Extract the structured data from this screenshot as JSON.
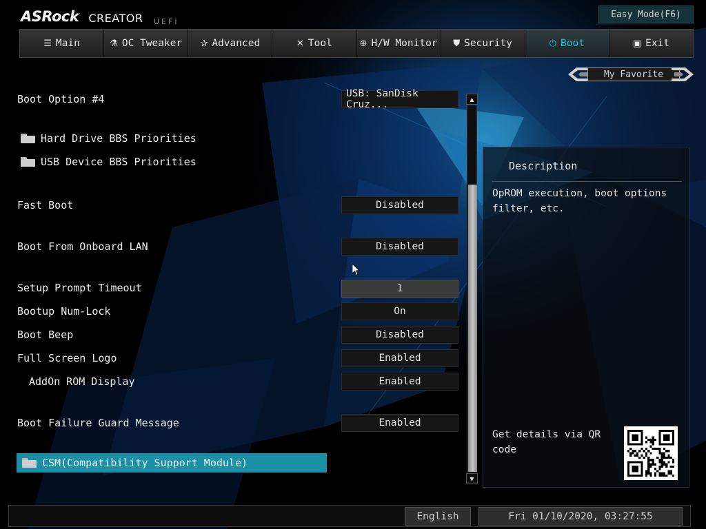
{
  "header": {
    "brand": "ASRock",
    "product": "CREATOR",
    "sublabel": "UEFI",
    "easy_mode_label": "Easy Mode(F6)"
  },
  "tabs": [
    {
      "label": "Main",
      "icon": "list-icon",
      "active": false
    },
    {
      "label": "OC Tweaker",
      "icon": "rocket-icon",
      "active": false
    },
    {
      "label": "Advanced",
      "icon": "star-icon",
      "active": false
    },
    {
      "label": "Tool",
      "icon": "tools-icon",
      "active": false
    },
    {
      "label": "H/W Monitor",
      "icon": "monitor-icon",
      "active": false
    },
    {
      "label": "Security",
      "icon": "shield-icon",
      "active": false
    },
    {
      "label": "Boot",
      "icon": "power-icon",
      "active": true
    },
    {
      "label": "Exit",
      "icon": "exit-door-icon",
      "active": false
    }
  ],
  "my_favorite_label": "My Favorite",
  "settings": {
    "boot_option_4": {
      "label": "Boot Option #4",
      "value": "USB: SanDisk Cruz..."
    },
    "hdd_bbs": {
      "label": "Hard Drive BBS Priorities"
    },
    "usb_bbs": {
      "label": "USB Device BBS Priorities"
    },
    "fast_boot": {
      "label": "Fast Boot",
      "value": "Disabled"
    },
    "boot_lan": {
      "label": "Boot From Onboard LAN",
      "value": "Disabled"
    },
    "prompt_timeout": {
      "label": "Setup Prompt Timeout",
      "value": "1"
    },
    "num_lock": {
      "label": "Bootup Num-Lock",
      "value": "On"
    },
    "boot_beep": {
      "label": "Boot Beep",
      "value": "Disabled"
    },
    "full_screen_logo": {
      "label": "Full Screen Logo",
      "value": "Enabled"
    },
    "addon_rom": {
      "label": "AddOn ROM Display",
      "value": "Enabled"
    },
    "failure_guard": {
      "label": "Boot Failure Guard Message",
      "value": "Enabled"
    },
    "csm": {
      "label": "CSM(Compatibility Support Module)"
    }
  },
  "description": {
    "title": "Description",
    "text": "OpROM execution, boot options filter, etc.",
    "qr_text": "Get details via QR code"
  },
  "footer": {
    "language": "English",
    "datetime": "Fri 01/10/2020, 03:27:55"
  },
  "colors": {
    "accent": "#27c4e3",
    "selected_row": "#1a8fa6",
    "panel_bg": "#0a0e14"
  }
}
